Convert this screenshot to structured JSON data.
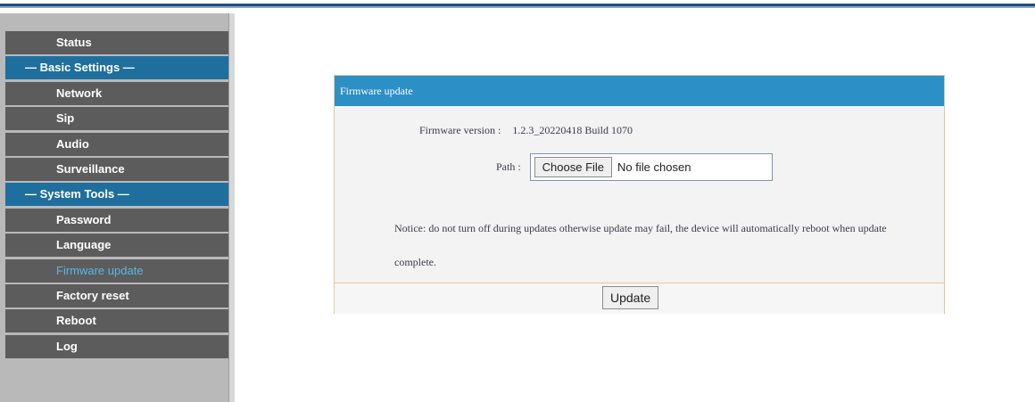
{
  "sidebar": {
    "items": [
      {
        "label": "Status",
        "type": "item"
      },
      {
        "label": "— Basic Settings —",
        "type": "section"
      },
      {
        "label": "Network",
        "type": "item"
      },
      {
        "label": "Sip",
        "type": "item"
      },
      {
        "label": "Audio",
        "type": "item"
      },
      {
        "label": "Surveillance",
        "type": "item"
      },
      {
        "label": "— System Tools —",
        "type": "section"
      },
      {
        "label": "Password",
        "type": "item"
      },
      {
        "label": "Language",
        "type": "item"
      },
      {
        "label": "Firmware update",
        "type": "item",
        "active": true
      },
      {
        "label": "Factory reset",
        "type": "item"
      },
      {
        "label": "Reboot",
        "type": "item"
      },
      {
        "label": "Log",
        "type": "item"
      }
    ]
  },
  "panel": {
    "title": "Firmware update",
    "version_label": "Firmware version :",
    "version_value": "1.2.3_20220418 Build 1070",
    "path_label": "Path :",
    "choose_file_label": "Choose File",
    "no_file_text": "No file chosen",
    "notice": "Notice:  do not turn off during updates otherwise update may fail, the device will automatically reboot when update complete.",
    "update_label": "Update"
  },
  "colors": {
    "header_blue": "#2c8fc6",
    "section_blue": "#1f6f9e",
    "menu_gray": "#5c5c5c",
    "active_text": "#58b7ea"
  }
}
